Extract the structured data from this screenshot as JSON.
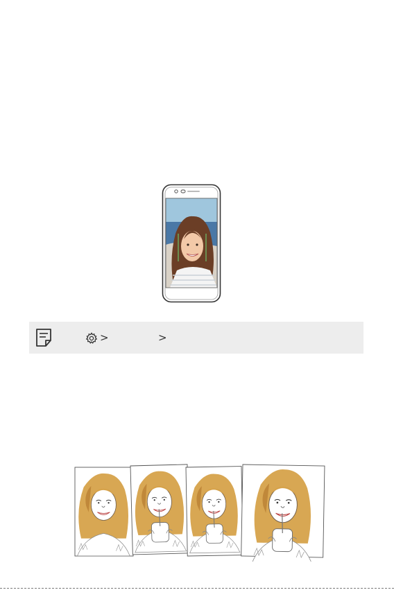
{
  "phone_illustration": {
    "icon": "smartphone-selfie-illustration",
    "screen_sky_color": "#9fc6dd",
    "screen_sea_color": "#4a78a6",
    "hair_color": "#6b3e26",
    "frame_guide_color": "#6cc36c"
  },
  "note": {
    "icon": "note-icon",
    "settings_icon": "gear-icon",
    "separator_1": ">",
    "separator_2": ">"
  },
  "sketch_strip": {
    "icon": "sketch-frames-illustration",
    "hair_color": "#d6a24a",
    "frame_count": 4
  }
}
